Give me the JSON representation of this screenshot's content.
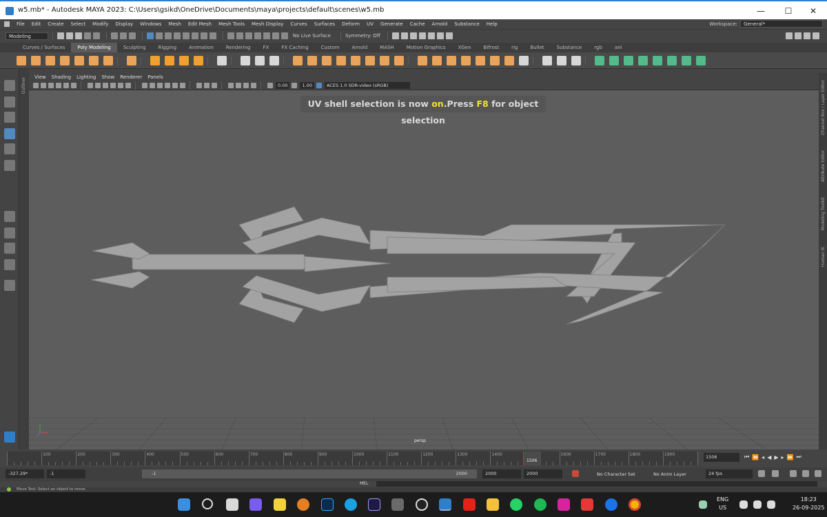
{
  "window": {
    "title": "w5.mb* - Autodesk MAYA 2023: C:\\Users\\gsikd\\OneDrive\\Documents\\maya\\projects\\default\\scenes\\w5.mb",
    "minimize": "—",
    "maximize": "☐",
    "close": "✕"
  },
  "menus": [
    "File",
    "Edit",
    "Create",
    "Select",
    "Modify",
    "Display",
    "Windows",
    "Mesh",
    "Edit Mesh",
    "Mesh Tools",
    "Mesh Display",
    "Curves",
    "Surfaces",
    "Deform",
    "UV",
    "Generate",
    "Cache",
    "Arnold",
    "Substance",
    "Help"
  ],
  "workspace": {
    "label": "Workspace:",
    "value": "General*"
  },
  "statusline": {
    "mode": "Modeling",
    "live_surface": "No Live Surface",
    "symmetry": "Symmetry: Off"
  },
  "shelf_tabs": [
    {
      "label": "Curves / Surfaces",
      "active": false
    },
    {
      "label": "Poly Modeling",
      "active": true
    },
    {
      "label": "Sculpting",
      "active": false
    },
    {
      "label": "Rigging",
      "active": false
    },
    {
      "label": "Animation",
      "active": false
    },
    {
      "label": "Rendering",
      "active": false
    },
    {
      "label": "FX",
      "active": false
    },
    {
      "label": "FX Caching",
      "active": false
    },
    {
      "label": "Custom",
      "active": false
    },
    {
      "label": "Arnold",
      "active": false
    },
    {
      "label": "MASH",
      "active": false
    },
    {
      "label": "Motion Graphics",
      "active": false
    },
    {
      "label": "XGen",
      "active": false
    },
    {
      "label": "Bifrost",
      "active": false
    },
    {
      "label": "rig",
      "active": false
    },
    {
      "label": "Bullet",
      "active": false
    },
    {
      "label": "Substance",
      "active": false
    },
    {
      "label": "rgb",
      "active": false
    },
    {
      "label": "ani",
      "active": false
    }
  ],
  "viewport": {
    "menus": [
      "View",
      "Shading",
      "Lighting",
      "Show",
      "Renderer",
      "Panels"
    ],
    "near_value": "0.00",
    "gamma_value": "1.00",
    "color_space": "ACES 1.0 SDR-video (sRGB)",
    "camera_label": "persp",
    "hud": {
      "pre": "UV shell selection is now ",
      "on": "on",
      "mid": ".Press ",
      "key": "F8",
      "post": " for object selection"
    }
  },
  "side_labels": {
    "outliner": "Outliner",
    "right": [
      "Channel Box / Layer Editor",
      "Attribute Editor",
      "Modeling Toolkit",
      "Human IK"
    ]
  },
  "timeline": {
    "ticks": [
      "100",
      "200",
      "300",
      "400",
      "500",
      "600",
      "700",
      "800",
      "900",
      "1000",
      "1100",
      "1200",
      "1300",
      "1400",
      "1500",
      "1600",
      "1700",
      "1800",
      "1900"
    ],
    "current_frame_label": "1506",
    "current_frame_field": "1506"
  },
  "range": {
    "current_value": "-327.29*",
    "start": "-1",
    "slider_start": "-1",
    "slider_end": "2000",
    "end_field1": "2000",
    "end_field2": "2000",
    "character_set": "No Character Set",
    "anim_layer": "No Anim Layer",
    "fps": "24 fps"
  },
  "cmdline": {
    "lang": "MEL"
  },
  "helpline": {
    "text": "Move Tool: Select an object to move."
  },
  "taskbar": {
    "lang_top": "ENG",
    "lang_bottom": "US",
    "time": "18:23",
    "date": "26-09-2025"
  },
  "colors": {
    "accent_blue": "#5289c1",
    "hud_highlight": "#f2e229",
    "viewport_bg": "#5d5d5d",
    "mesh_fill": "#a3a3a3"
  }
}
